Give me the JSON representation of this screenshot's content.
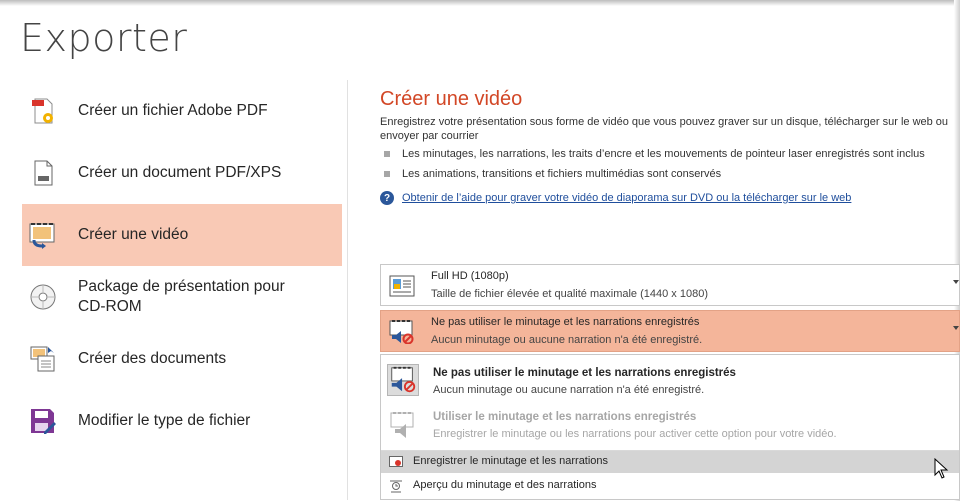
{
  "page": {
    "title": "Exporter"
  },
  "sidebar": {
    "items": [
      {
        "label": "Créer un fichier Adobe PDF",
        "icon": "adobe-pdf-icon",
        "active": false
      },
      {
        "label": "Créer un document PDF/XPS",
        "icon": "pdf-xps-document-icon",
        "active": false
      },
      {
        "label": "Créer une vidéo",
        "icon": "video-icon",
        "active": true
      },
      {
        "label": "Package de présentation pour CD-ROM",
        "icon": "cd-rom-icon",
        "active": false
      },
      {
        "label": "Créer des documents",
        "icon": "handouts-icon",
        "active": false
      },
      {
        "label": "Modifier le type de fichier",
        "icon": "save-as-icon",
        "active": false
      }
    ]
  },
  "main": {
    "heading": "Créer une vidéo",
    "description": "Enregistrez votre présentation sous forme de vidéo que vous pouvez graver sur un disque, télécharger sur le web ou envoyer par courrier",
    "bullets": [
      "Les minutages, les narrations, les traits d’encre et les mouvements de pointeur laser enregistrés sont inclus",
      "Les animations, transitions et fichiers multimédias sont conservés"
    ],
    "help_link": "Obtenir de l’aide pour graver votre vidéo de diaporama sur DVD ou la télécharger sur le web"
  },
  "resolution_dropdown": {
    "title": "Full HD (1080p)",
    "subtitle": "Taille de fichier élevée et qualité maximale (1440 x 1080)"
  },
  "timing_dropdown": {
    "title": "Ne pas utiliser le minutage et les narrations enregistrés",
    "subtitle": "Aucun minutage ou aucune narration n'a été enregistré."
  },
  "timing_menu": {
    "options": [
      {
        "title": "Ne pas utiliser le minutage et les narrations enregistrés",
        "subtitle": "Aucun minutage ou aucune narration n'a été enregistré.",
        "enabled": true
      },
      {
        "title": "Utiliser le minutage et les narrations enregistrés",
        "subtitle": "Enregistrer le minutage ou les narrations pour activer cette option pour votre vidéo.",
        "enabled": false
      }
    ],
    "record_label": "Enregistrer le minutage et les narrations",
    "preview_label": "Aperçu du minutage et des narrations"
  },
  "colors": {
    "accent": "#d24726",
    "active_item_bg": "#f9c9b5",
    "dropdown_highlight": "#f4b59a",
    "link": "#1f4e9c"
  }
}
